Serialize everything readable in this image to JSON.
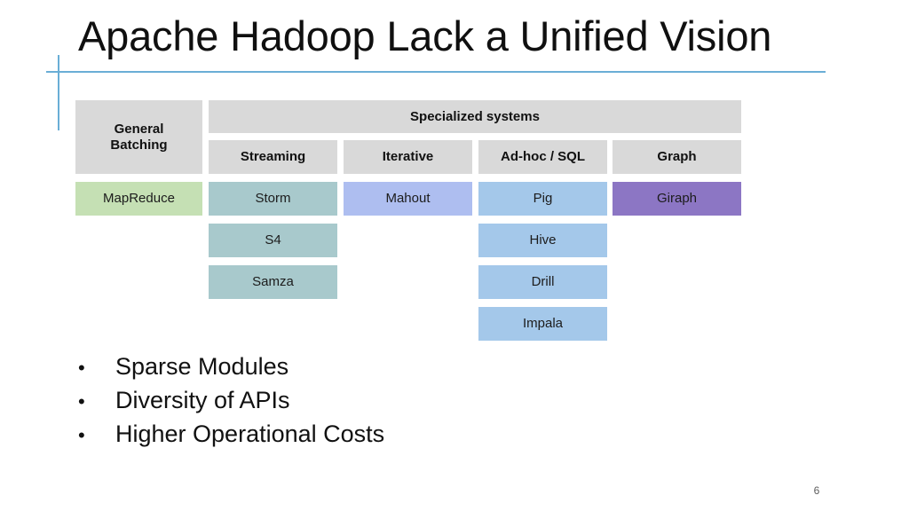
{
  "slide": {
    "title": "Apache Hadoop Lack a Unified Vision",
    "number": "6",
    "accent_color": "#6aaed6"
  },
  "diagram": {
    "general_batching": {
      "label": "General\nBatching",
      "line1": "General",
      "line2": "Batching",
      "color": "#d9d9d9"
    },
    "specialized_banner": {
      "label": "Specialized systems",
      "color": "#d9d9d9"
    },
    "columns": [
      {
        "key": "general-batching",
        "header": "General Batching",
        "header_color": "#d9d9d9",
        "items": [
          {
            "label": "MapReduce",
            "color": "#c5e0b4"
          }
        ]
      },
      {
        "key": "streaming",
        "header": "Streaming",
        "header_color": "#d9d9d9",
        "items": [
          {
            "label": "Storm",
            "color": "#a8c9cc"
          },
          {
            "label": "S4",
            "color": "#a8c9cc"
          },
          {
            "label": "Samza",
            "color": "#a8c9cc"
          }
        ]
      },
      {
        "key": "iterative",
        "header": "Iterative",
        "header_color": "#d9d9d9",
        "items": [
          {
            "label": "Mahout",
            "color": "#aebef0"
          }
        ]
      },
      {
        "key": "adhoc-sql",
        "header": "Ad-hoc / SQL",
        "header_color": "#d9d9d9",
        "items": [
          {
            "label": "Pig",
            "color": "#a4c8ea"
          },
          {
            "label": "Hive",
            "color": "#a4c8ea"
          },
          {
            "label": "Drill",
            "color": "#a4c8ea"
          },
          {
            "label": "Impala",
            "color": "#a4c8ea"
          }
        ]
      },
      {
        "key": "graph",
        "header": "Graph",
        "header_color": "#d9d9d9",
        "items": [
          {
            "label": "Giraph",
            "color": "#8c76c4"
          }
        ]
      }
    ]
  },
  "bullets": [
    {
      "marker": "•",
      "text": "Sparse Modules"
    },
    {
      "marker": "•",
      "text": "Diversity of APIs"
    },
    {
      "marker": "•",
      "text": "Higher Operational Costs"
    }
  ]
}
